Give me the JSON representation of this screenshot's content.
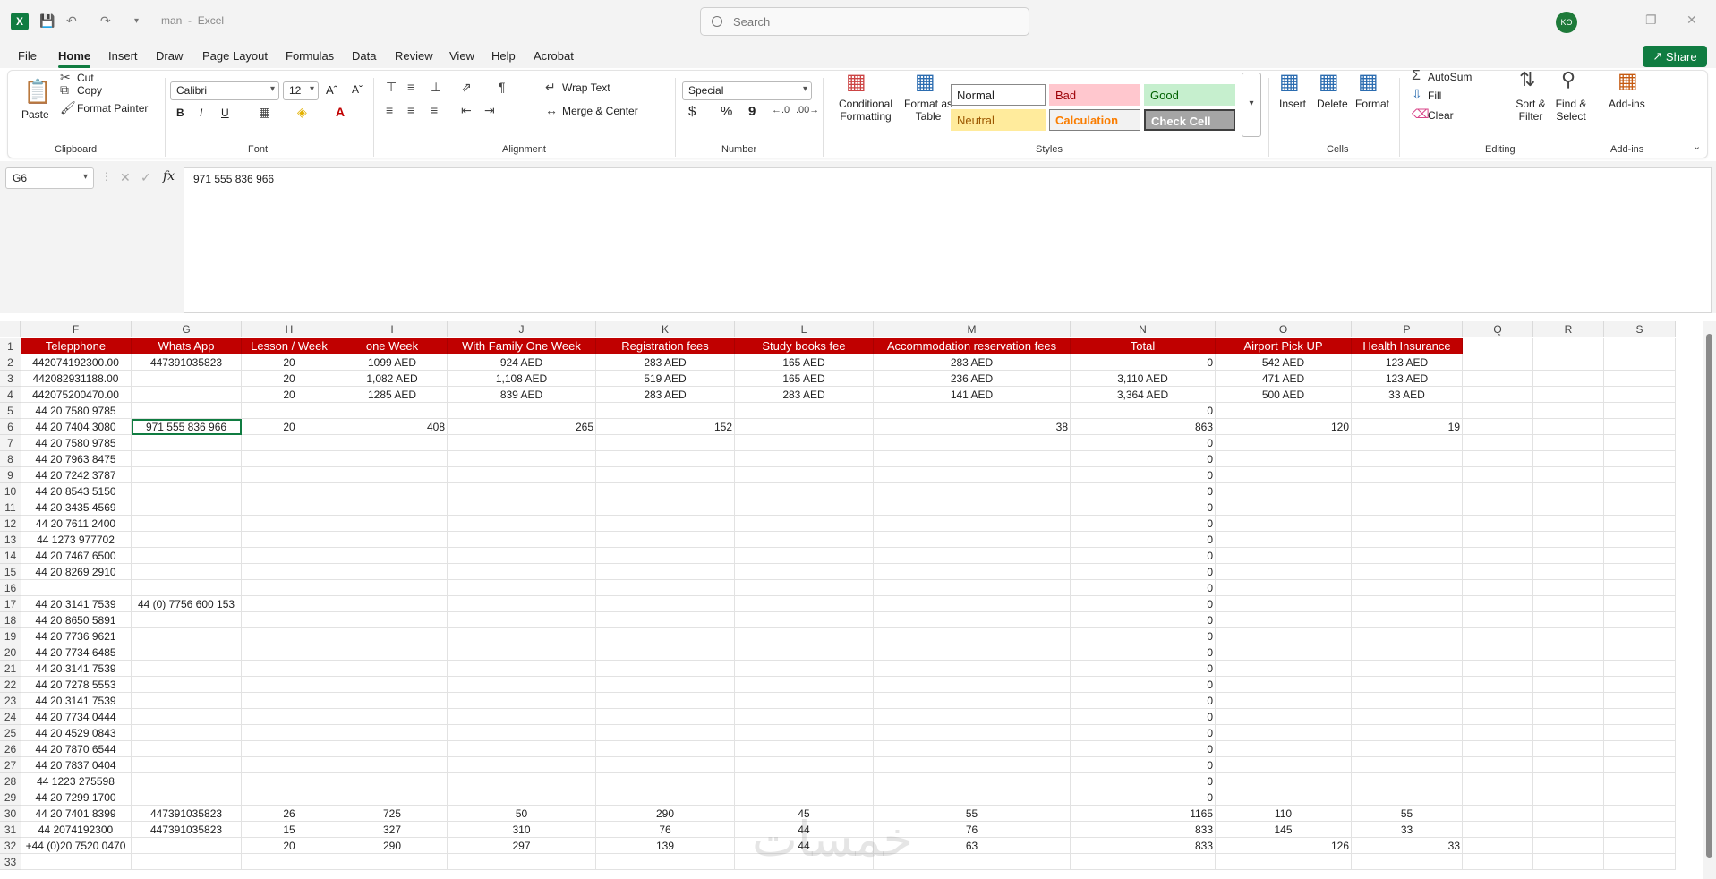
{
  "titlebar": {
    "doc_name": "man",
    "app_name": "Excel",
    "search_placeholder": "Search",
    "avatar_initials": "KO"
  },
  "menu": [
    "File",
    "Home",
    "Insert",
    "Draw",
    "Page Layout",
    "Formulas",
    "Data",
    "Review",
    "View",
    "Help",
    "Acrobat"
  ],
  "share_label": "Share",
  "ribbon": {
    "clipboard": {
      "paste": "Paste",
      "cut": "Cut",
      "copy": "Copy",
      "format_painter": "Format Painter",
      "group": "Clipboard"
    },
    "font": {
      "name": "Calibri",
      "size": "12",
      "group": "Font",
      "bold": "B",
      "italic": "I",
      "underline": "U"
    },
    "alignment": {
      "wrap": "Wrap Text",
      "merge": "Merge & Center",
      "group": "Alignment"
    },
    "number": {
      "format": "Special",
      "group": "Number",
      "currency": "$",
      "percent": "%",
      "comma": "9"
    },
    "styles": {
      "conditional": "Conditional Formatting",
      "format_table": "Format as Table",
      "group": "Styles",
      "normal": "Normal",
      "bad": "Bad",
      "good": "Good",
      "neutral": "Neutral",
      "calculation": "Calculation",
      "check": "Check Cell"
    },
    "cells": {
      "insert": "Insert",
      "delete": "Delete",
      "format": "Format",
      "group": "Cells"
    },
    "editing": {
      "autosum": "AutoSum",
      "fill": "Fill",
      "clear": "Clear",
      "sort": "Sort & Filter",
      "find": "Find & Select",
      "group": "Editing"
    },
    "addins": {
      "label": "Add-ins",
      "group": "Add-ins"
    }
  },
  "formula_bar": {
    "name_box": "G6",
    "value": "971 555 836 966"
  },
  "columns": [
    "F",
    "G",
    "H",
    "I",
    "J",
    "K",
    "L",
    "M",
    "N",
    "O",
    "P",
    "Q",
    "R",
    "S"
  ],
  "headers": [
    "Telepphone",
    "Whats App",
    "Lesson / Week",
    "one Week",
    "With Family One Week",
    "Registration fees",
    "Study books fee",
    "Accommodation reservation fees",
    "Total",
    "Airport Pick UP",
    "Health Insurance"
  ],
  "rows": [
    [
      "442074192300.00",
      "447391035823",
      "20",
      "1099 AED",
      "924 AED",
      "283 AED",
      "165 AED",
      "283 AED",
      "0",
      "542 AED",
      "123 AED"
    ],
    [
      "442082931188.00",
      "",
      "20",
      "1,082 AED",
      "1,108 AED",
      "519 AED",
      "165 AED",
      "236 AED",
      "3,110 AED",
      "471 AED",
      "123 AED"
    ],
    [
      "442075200470.00",
      "",
      "20",
      "1285 AED",
      "839 AED",
      "283 AED",
      "283 AED",
      "141 AED",
      "3,364 AED",
      "500 AED",
      "33 AED"
    ],
    [
      "44 20 7580 9785",
      "",
      "",
      "",
      "",
      "",
      "",
      "",
      "0",
      "",
      ""
    ],
    [
      "44 20 7404 3080",
      "971 555 836 966",
      "20",
      "408",
      "265",
      "152",
      "",
      "38",
      "863",
      "120",
      "19"
    ],
    [
      "44 20 7580 9785",
      "",
      "",
      "",
      "",
      "",
      "",
      "",
      "0",
      "",
      ""
    ],
    [
      "44 20 7963 8475",
      "",
      "",
      "",
      "",
      "",
      "",
      "",
      "0",
      "",
      ""
    ],
    [
      "44 20 7242 3787",
      "",
      "",
      "",
      "",
      "",
      "",
      "",
      "0",
      "",
      ""
    ],
    [
      "44 20 8543 5150",
      "",
      "",
      "",
      "",
      "",
      "",
      "",
      "0",
      "",
      ""
    ],
    [
      "44 20 3435 4569",
      "",
      "",
      "",
      "",
      "",
      "",
      "",
      "0",
      "",
      ""
    ],
    [
      "44 20 7611 2400",
      "",
      "",
      "",
      "",
      "",
      "",
      "",
      "0",
      "",
      ""
    ],
    [
      "44 1273 977702",
      "",
      "",
      "",
      "",
      "",
      "",
      "",
      "0",
      "",
      ""
    ],
    [
      "44 20 7467 6500",
      "",
      "",
      "",
      "",
      "",
      "",
      "",
      "0",
      "",
      ""
    ],
    [
      "44 20 8269 2910",
      "",
      "",
      "",
      "",
      "",
      "",
      "",
      "0",
      "",
      ""
    ],
    [
      "",
      "",
      "",
      "",
      "",
      "",
      "",
      "",
      "0",
      "",
      ""
    ],
    [
      "44 20 3141 7539",
      "44 (0) 7756 600 153",
      "",
      "",
      "",
      "",
      "",
      "",
      "0",
      "",
      ""
    ],
    [
      "44 20 8650 5891",
      "",
      "",
      "",
      "",
      "",
      "",
      "",
      "0",
      "",
      ""
    ],
    [
      "44 20 7736 9621",
      "",
      "",
      "",
      "",
      "",
      "",
      "",
      "0",
      "",
      ""
    ],
    [
      "44 20 7734 6485",
      "",
      "",
      "",
      "",
      "",
      "",
      "",
      "0",
      "",
      ""
    ],
    [
      "44 20 3141 7539",
      "",
      "",
      "",
      "",
      "",
      "",
      "",
      "0",
      "",
      ""
    ],
    [
      "44 20 7278 5553",
      "",
      "",
      "",
      "",
      "",
      "",
      "",
      "0",
      "",
      ""
    ],
    [
      "44 20 3141 7539",
      "",
      "",
      "",
      "",
      "",
      "",
      "",
      "0",
      "",
      ""
    ],
    [
      "44 20 7734 0444",
      "",
      "",
      "",
      "",
      "",
      "",
      "",
      "0",
      "",
      ""
    ],
    [
      "44 20 4529 0843",
      "",
      "",
      "",
      "",
      "",
      "",
      "",
      "0",
      "",
      ""
    ],
    [
      "44 20 7870 6544",
      "",
      "",
      "",
      "",
      "",
      "",
      "",
      "0",
      "",
      ""
    ],
    [
      "44 20 7837 0404",
      "",
      "",
      "",
      "",
      "",
      "",
      "",
      "0",
      "",
      ""
    ],
    [
      "44 1223 275598",
      "",
      "",
      "",
      "",
      "",
      "",
      "",
      "0",
      "",
      ""
    ],
    [
      "44 20 7299 1700",
      "",
      "",
      "",
      "",
      "",
      "",
      "",
      "0",
      "",
      ""
    ],
    [
      "44 20 7401 8399",
      "447391035823",
      "26",
      "725",
      "50",
      "290",
      "45",
      "55",
      "1165",
      "110",
      "55"
    ],
    [
      "44 2074192300",
      "447391035823",
      "15",
      "327",
      "310",
      "76",
      "44",
      "76",
      "833",
      "145",
      "33"
    ],
    [
      "+44 (0)20 7520 0470",
      "",
      "20",
      "290",
      "297",
      "139",
      "44",
      "63",
      "833",
      "126",
      "33"
    ],
    [
      "",
      "",
      "",
      "",
      "",
      "",
      "",
      "",
      "",
      "",
      ""
    ]
  ],
  "colors": {
    "header_bg": "#c00000",
    "accent": "#107c41"
  }
}
